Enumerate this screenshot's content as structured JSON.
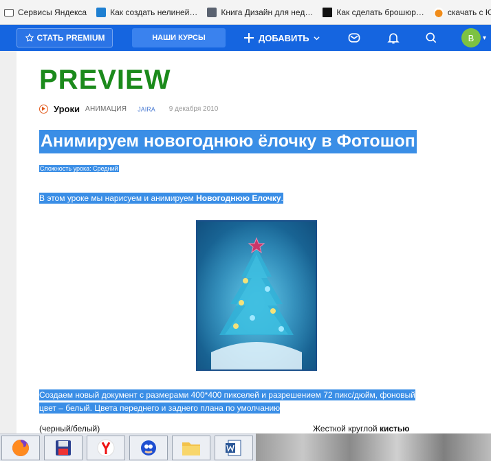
{
  "bookmarks": [
    {
      "label": "Сервисы Яндекса",
      "icon": "folder-icon"
    },
    {
      "label": "Как создать нелиней…",
      "icon": "presentation-icon"
    },
    {
      "label": "Книга Дизайн для нед…",
      "icon": "book-icon"
    },
    {
      "label": "Как сделать брошюр…",
      "icon": "monitor-icon"
    },
    {
      "label": "скачать с ЮтуС",
      "icon": "download-icon"
    }
  ],
  "nav": {
    "premium_label": "СТАТЬ PREMIUM",
    "courses_label": "НАШИ КУРСЫ",
    "add_label": "ДОБАВИТЬ",
    "avatar_letter": "B"
  },
  "article": {
    "preview": "PREVIEW",
    "category": "Уроки",
    "tag": "АНИМАЦИЯ",
    "author": "JAIRA",
    "date": "9 декабря 2010",
    "headline": "Анимируем новогоднюю ёлочку в Фотошоп",
    "difficulty": "Сложность урока: Средний",
    "intro_prefix": "В этом уроке мы нарисуем и анимируем ",
    "intro_bold": "Новогоднюю Елочку",
    "intro_suffix": ".",
    "paragraph_line1": "Создаем новый документ с размерами 400*400 пикселей и разрешением 72 пикс/дюйм, фоновый",
    "paragraph_line2": "цвет – белый. Цвета переднего и заднего плана по умолчанию",
    "bottom_left": "(черный/белый)",
    "bottom_right_prefix": "Жесткой круглой ",
    "bottom_right_bold": "кистью"
  },
  "colors": {
    "nav_blue": "#1565e0",
    "preview_green": "#1b8a1b",
    "selection_blue": "#3a8ee6",
    "category_icon": "#e25a1c",
    "author_link": "#4a7bd3"
  },
  "taskbar": [
    {
      "name": "firefox-icon"
    },
    {
      "name": "floppy-save-icon"
    },
    {
      "name": "yandex-browser-icon"
    },
    {
      "name": "sonic-game-icon"
    },
    {
      "name": "file-explorer-icon"
    },
    {
      "name": "word-icon"
    }
  ]
}
